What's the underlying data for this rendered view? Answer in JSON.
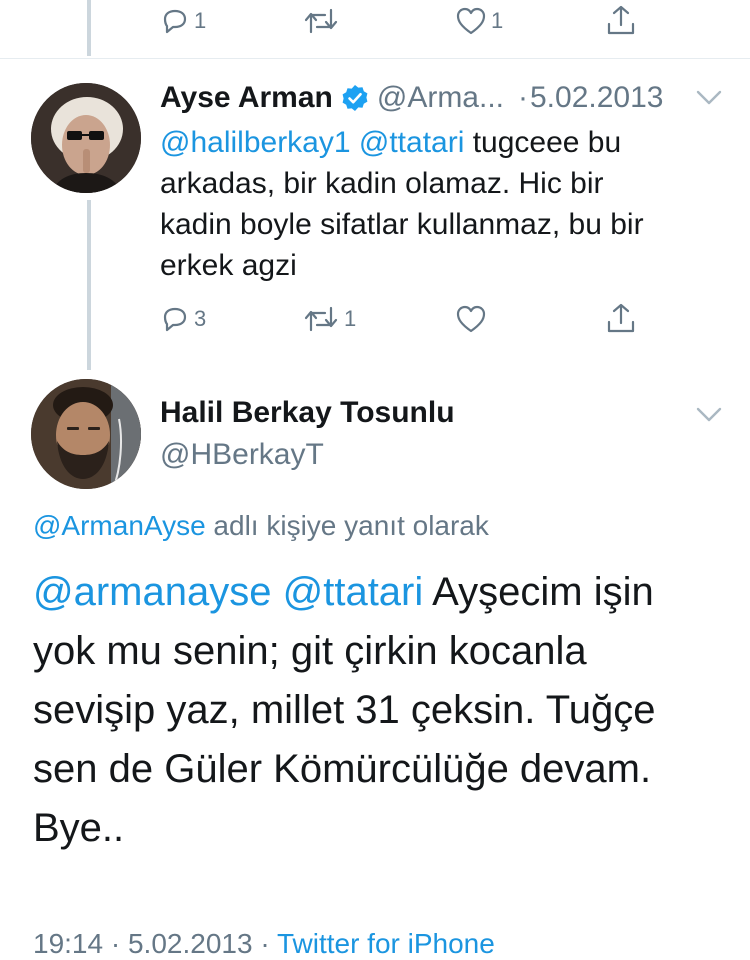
{
  "colors": {
    "link": "#1b95e0",
    "verified": "#1da1f2",
    "gray": "#657786",
    "line": "#ccd6dd"
  },
  "top_actions": {
    "reply_count": "1",
    "like_count": "1"
  },
  "tweet1": {
    "name": "Ayse Arman",
    "handle": "@Arma...",
    "sep": "·",
    "date": "5.02.2013",
    "mention1": "@halilberkay1",
    "mention2": "@ttatari",
    "line1_rest": "tugceee bu",
    "line2": "arkadas, bir kadin olamaz. Hic bir",
    "line3": "kadin boyle sifatlar kullanmaz, bu bir",
    "line4": "erkek agzi",
    "reply_count": "3",
    "retweet_count": "1",
    "icons": {
      "reply": "reply-icon",
      "retweet": "retweet-icon",
      "like": "heart-icon",
      "share": "share-icon",
      "more": "chevron-down-icon",
      "verified": "verified-badge-icon"
    }
  },
  "tweet2": {
    "name": "Halil Berkay Tosunlu",
    "handle": "@HBerkayT",
    "reply_to_handle": "@ArmanAyse",
    "reply_to_suffix": "adlı kişiye yanıt olarak",
    "mention1": "@armanayse",
    "mention2": "@ttatari",
    "line1_rest": "Ayşecim işin",
    "line2": "yok mu senin; git çirkin kocanla",
    "line3": "sevişip yaz, millet 31 çeksin. Tuğçe",
    "line4": "sen de Güler Kömürcülüğe devam.",
    "line5": "Bye..",
    "footer_time": "19:14",
    "footer_sep1": "·",
    "footer_date": "5.02.2013",
    "footer_sep2": "·",
    "footer_source": "Twitter for iPhone"
  }
}
